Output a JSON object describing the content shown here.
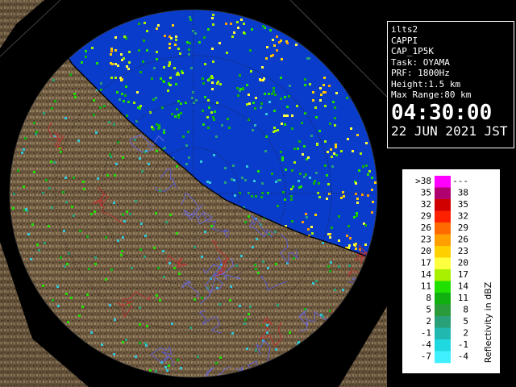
{
  "info": {
    "site": "ilts2",
    "product": "CAPPI",
    "scan": "CAP_1P5K",
    "task": "Task: OYAMA",
    "prf": "PRF: 1800Hz",
    "height": "Height:1.5 km",
    "max_range": "Max Range:80 km",
    "time": "04:30:00",
    "date": "22 JUN 2021 JST"
  },
  "legend": {
    "title": "Reflectivity in dBZ",
    "rows": [
      {
        "low": ">38",
        "high": "---",
        "color": "#ff00ff"
      },
      {
        "low": "35",
        "high": "38",
        "color": "#b00070"
      },
      {
        "low": "32",
        "high": "35",
        "color": "#d00000"
      },
      {
        "low": "29",
        "high": "32",
        "color": "#ff2000"
      },
      {
        "low": "26",
        "high": "29",
        "color": "#ff6a00"
      },
      {
        "low": "23",
        "high": "26",
        "color": "#ffa000"
      },
      {
        "low": "20",
        "high": "23",
        "color": "#ffd000"
      },
      {
        "low": "17",
        "high": "20",
        "color": "#ffff40"
      },
      {
        "low": "14",
        "high": "17",
        "color": "#a8f000"
      },
      {
        "low": "11",
        "high": "14",
        "color": "#20e000"
      },
      {
        "low": "8",
        "high": "11",
        "color": "#10b010"
      },
      {
        "low": "5",
        "high": "8",
        "color": "#2a9a3a"
      },
      {
        "low": "2",
        "high": "5",
        "color": "#2aa078"
      },
      {
        "low": "-1",
        "high": "2",
        "color": "#20b8b0"
      },
      {
        "low": "-4",
        "high": "-1",
        "color": "#20d8e0"
      },
      {
        "low": "-7",
        "high": "-4",
        "color": "#40f0ff"
      }
    ]
  },
  "map": {
    "ocean_color": "#0a3ccc",
    "land_color": "#7a6448",
    "echo_palette": [
      "#1e8ce0",
      "#30c8d8",
      "#2aa078",
      "#10b010",
      "#20e000",
      "#a8f000",
      "#ffff40",
      "#ffd000",
      "#ffa000"
    ]
  }
}
